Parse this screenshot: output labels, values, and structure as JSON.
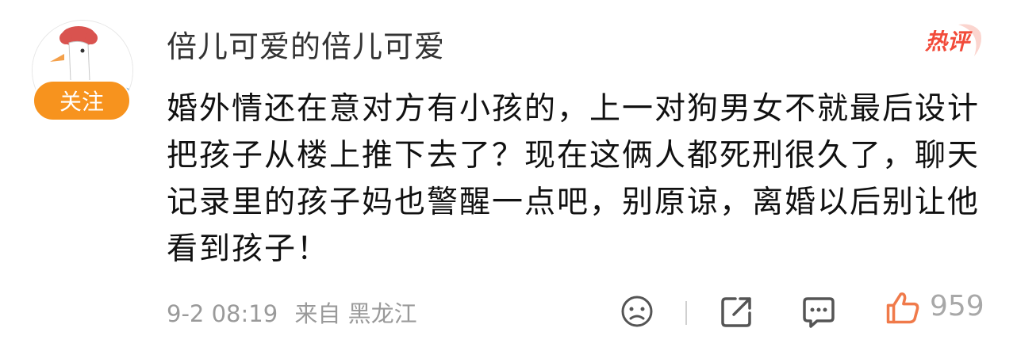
{
  "comment": {
    "username": "倍儿可爱的倍儿可爱",
    "follow_label": "关注",
    "hot_label": "热评",
    "text": "婚外情还在意对方有小孩的，上一对狗男女不就最后设计把孩子从楼上推下去了？现在这俩人都死刑很久了，聊天记录里的孩子妈也警醒一点吧，别原谅，离婚以后别让他看到孩子！",
    "date": "9-2 08:19",
    "source": "来自 黑龙江",
    "like_count": "959"
  },
  "icons": {
    "avatar": "goose-avatar",
    "emoji": "face-icon",
    "share": "share-icon",
    "comment": "comment-icon",
    "like": "thumbs-up-icon"
  },
  "colors": {
    "follow_bg": "#f7931e",
    "hot_label": "#f24b3a",
    "meta_text": "#9a9a9a"
  }
}
